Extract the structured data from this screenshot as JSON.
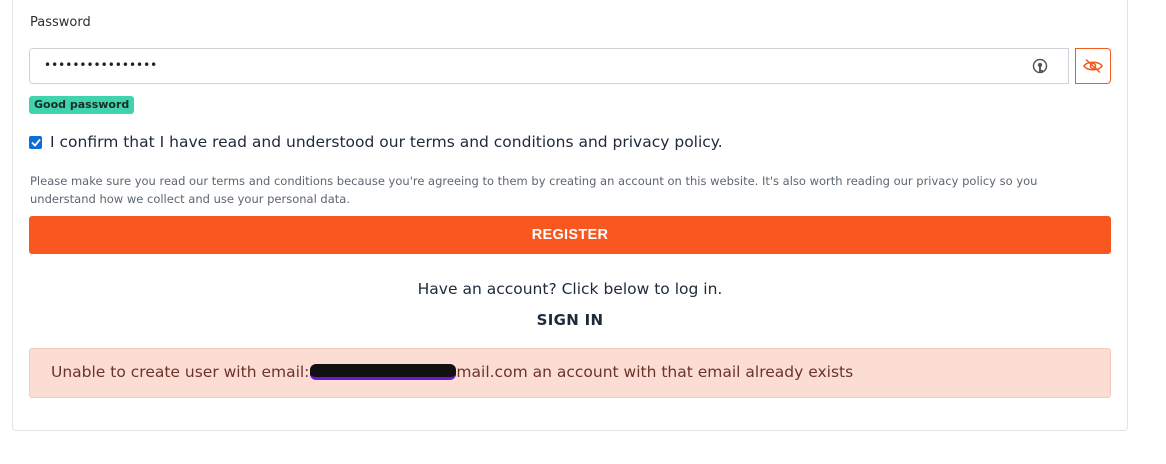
{
  "password": {
    "label": "Password",
    "value": "••••••••••••••••",
    "strength": "Good password",
    "icons": {
      "autofill": "password-key-icon",
      "toggle": "eye-slash-icon"
    }
  },
  "confirm": {
    "checked": true,
    "text": "I confirm that I have read and understood our terms and conditions and privacy policy."
  },
  "notice": "Please make sure you read our terms and conditions because you're agreeing to them by creating an account on this website. It's also worth reading our privacy policy so you understand how we collect and use your personal data.",
  "register": {
    "label": "REGISTER"
  },
  "login": {
    "prompt": "Have an account? Click below to log in.",
    "link": "SIGN IN"
  },
  "alert": {
    "prefix": "Unable to create user with email:",
    "suffix": "mail.com an account with that email already exists"
  },
  "colors": {
    "accent": "#f8571f",
    "badge": "#3fd4ae",
    "alert_bg": "#fcddd4",
    "checkbox": "#0b6ed9"
  }
}
